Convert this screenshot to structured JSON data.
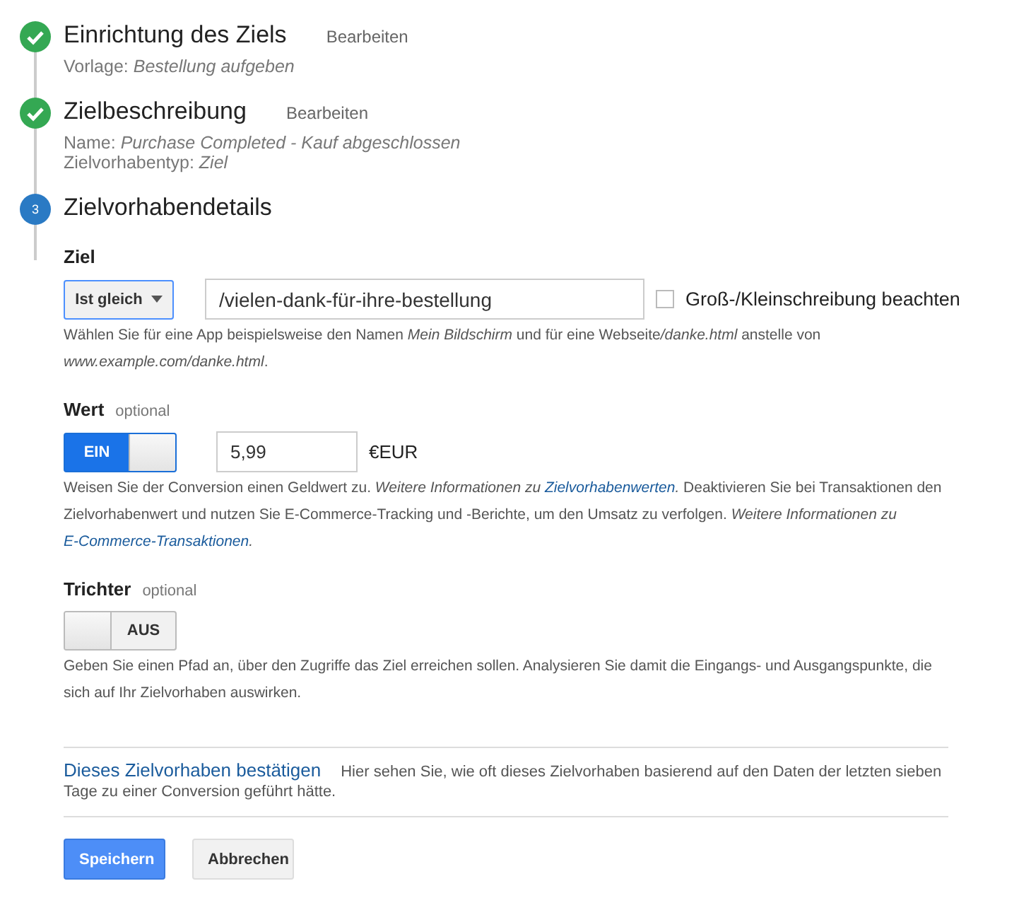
{
  "steps": [
    {
      "kind": "done",
      "title": "Einrichtung des Ziels",
      "edit_link": "Bearbeiten",
      "details": [
        {
          "label": "Vorlage:",
          "value": "Bestellung aufgeben"
        }
      ]
    },
    {
      "kind": "done",
      "title": "Zielbeschreibung",
      "edit_link": "Bearbeiten",
      "details": [
        {
          "label": "Name:",
          "value": "Purchase Completed - Kauf abgeschlossen"
        },
        {
          "label": "Zielvorhabentyp:",
          "value": "Ziel"
        }
      ]
    },
    {
      "kind": "current",
      "number": "3",
      "title": "Zielvorhabendetails"
    }
  ],
  "goal": {
    "label": "Ziel",
    "match_select": "Ist gleich",
    "url_field": "/vielen-dank-für-ihre-bestellung",
    "case_checkbox": {
      "label": "Groß-/Kleinschreibung beachten",
      "checked": false
    },
    "hint": [
      {
        "kind": "plain",
        "text": "Wählen Sie für eine App beispielsweise den Namen "
      },
      {
        "kind": "italic",
        "text": "Mein Bildschirm"
      },
      {
        "kind": "plain",
        "text": " und für eine Webseite"
      },
      {
        "kind": "italic",
        "text": "/danke.html"
      },
      {
        "kind": "plain",
        "text": " anstelle von "
      },
      {
        "kind": "italic",
        "text": "www.example.com/danke.html"
      },
      {
        "kind": "plain",
        "text": "."
      }
    ]
  },
  "value": {
    "label": "Wert",
    "optional": "optional",
    "toggle": {
      "on": true,
      "text": "EIN"
    },
    "amount": "5,99",
    "currency": "€EUR",
    "hint": [
      {
        "kind": "plain",
        "text": "Weisen Sie der Conversion einen Geldwert zu. "
      },
      {
        "kind": "italic",
        "text": "Weitere Informationen zu "
      },
      {
        "kind": "link",
        "text": "Zielvorhabenwerten"
      },
      {
        "kind": "italic",
        "text": "."
      },
      {
        "kind": "plain",
        "text": " Deaktivieren Sie bei Transaktionen den Zielvorhabenwert und nutzen Sie E-Commerce-Tracking und -Berichte, um den Umsatz zu verfolgen. "
      },
      {
        "kind": "italic",
        "text": "Weitere Informationen zu "
      },
      {
        "kind": "link",
        "text": "E-Commerce-Transaktionen"
      },
      {
        "kind": "italic",
        "text": "."
      }
    ]
  },
  "funnel": {
    "label": "Trichter",
    "optional": "optional",
    "toggle": {
      "on": false,
      "text": "AUS"
    },
    "hint": [
      {
        "kind": "plain",
        "text": "Geben Sie einen Pfad an, über den Zugriffe das Ziel erreichen sollen. Analysieren Sie damit die Eingangs- und Ausgangspunkte, die sich auf Ihr Zielvorhaben auswirken."
      }
    ]
  },
  "verify": {
    "link": "Dieses Zielvorhaben bestätigen",
    "text": "Hier sehen Sie, wie oft dieses Zielvorhaben basierend auf den Daten der letzten sieben Tage zu einer Conversion geführt hätte."
  },
  "buttons": [
    {
      "kind": "primary",
      "label": "Speichern"
    },
    {
      "kind": "secondary",
      "label": "Abbrechen"
    }
  ]
}
